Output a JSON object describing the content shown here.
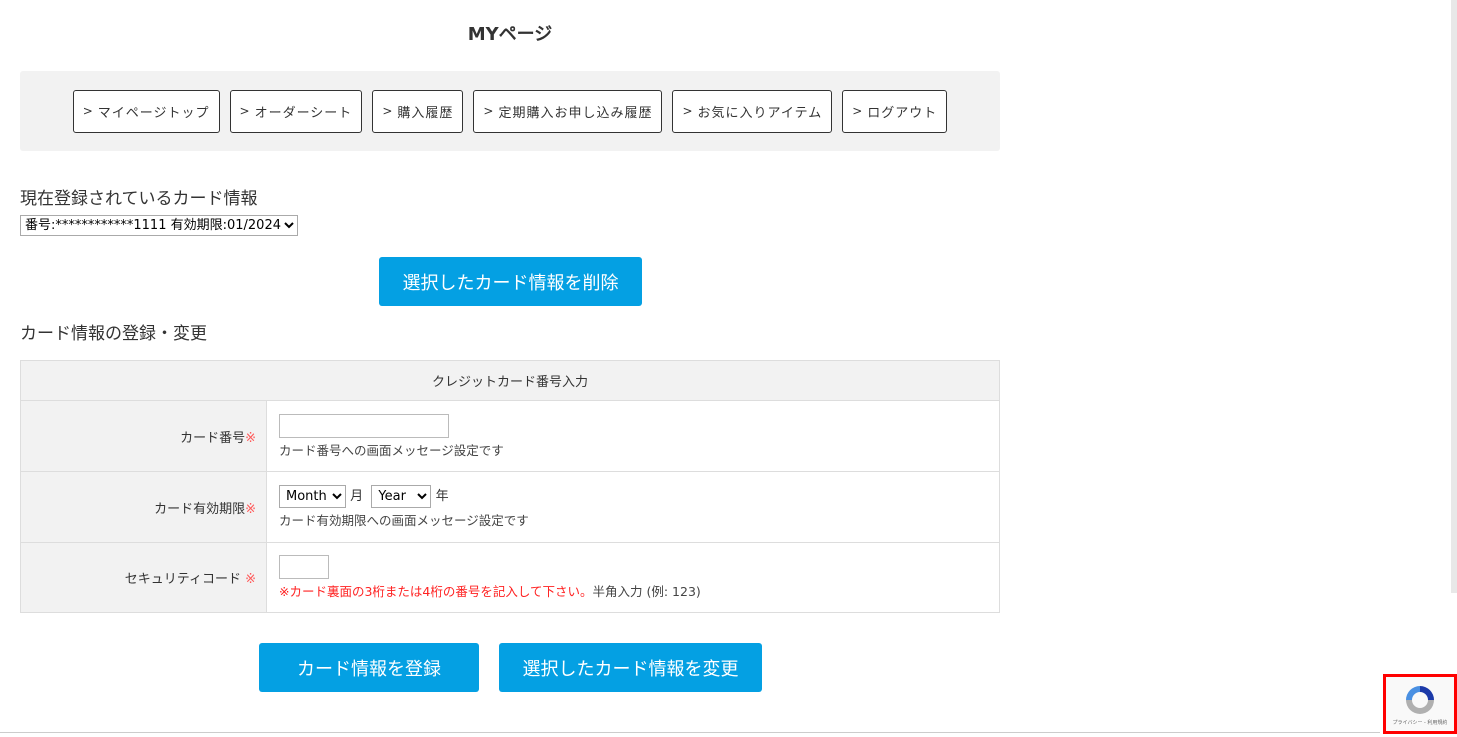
{
  "title": "MYページ",
  "nav": [
    "マイページトップ",
    "オーダーシート",
    "購入履歴",
    "定期購入お申し込み履歴",
    "お気に入りアイテム",
    "ログアウト"
  ],
  "registered": {
    "heading": "現在登録されているカード情報",
    "selected_card": "番号:************1111 有効期限:01/2024",
    "delete_label": "選択したカード情報を削除"
  },
  "register": {
    "heading": "カード情報の登録・変更",
    "table_header": "クレジットカード番号入力",
    "card_number_label": "カード番号",
    "card_number_note": "カード番号への画面メッセージ設定です",
    "expiry_label": "カード有効期限",
    "month_value": "Month",
    "month_unit": "月",
    "year_value": "Year",
    "year_unit": "年",
    "expiry_note": "カード有効期限への画面メッセージ設定です",
    "cvc_label": "セキュリティコード",
    "required_mark": "※",
    "cvc_note_red": "※カード裏面の3桁または4桁の番号を記入して下さい。",
    "cvc_note": "半角入力 (例: 123)"
  },
  "buttons": {
    "register": "カード情報を登録",
    "change": "選択したカード情報を変更"
  },
  "recaptcha": {
    "text": "プライバシー - 利用規約"
  },
  "colors": {
    "accent": "#04a0e3",
    "required": "#ff5a5a"
  }
}
